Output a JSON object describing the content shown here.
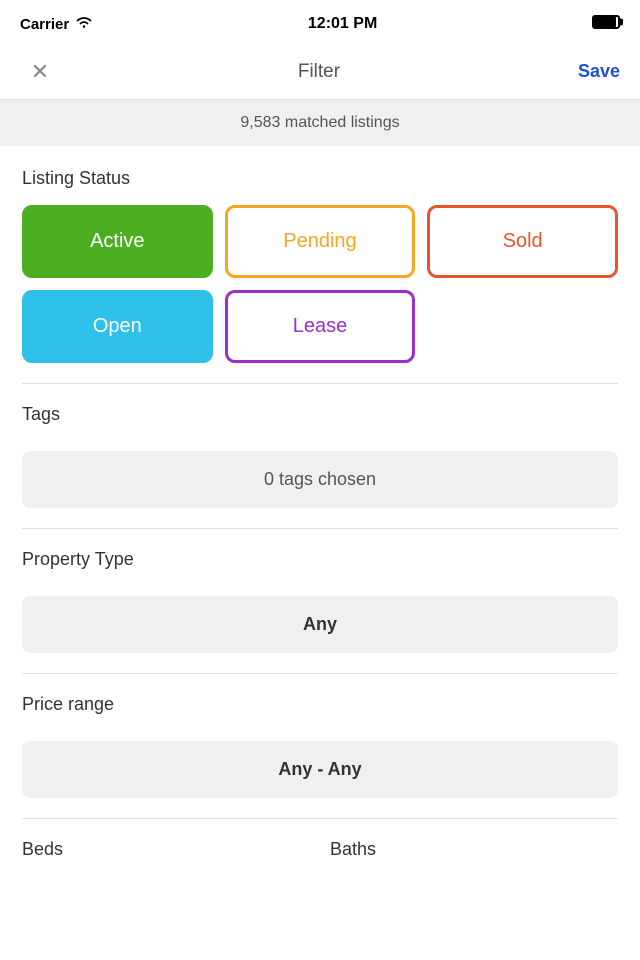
{
  "statusBar": {
    "carrier": "Carrier",
    "time": "12:01 PM"
  },
  "navBar": {
    "closeLabel": "✕",
    "title": "Filter",
    "saveLabel": "Save"
  },
  "matchedBanner": {
    "text": "9,583 matched listings"
  },
  "listingStatus": {
    "sectionTitle": "Listing Status",
    "buttons": [
      {
        "label": "Active",
        "style": "active"
      },
      {
        "label": "Pending",
        "style": "pending"
      },
      {
        "label": "Sold",
        "style": "sold"
      },
      {
        "label": "Open",
        "style": "open"
      },
      {
        "label": "Lease",
        "style": "lease"
      }
    ]
  },
  "tags": {
    "sectionTitle": "Tags",
    "dropdownLabel": "0 tags chosen"
  },
  "propertyType": {
    "sectionTitle": "Property Type",
    "dropdownLabel": "Any"
  },
  "priceRange": {
    "sectionTitle": "Price range",
    "dropdownLabel": "Any - Any"
  },
  "bedsSection": {
    "title": "Beds"
  },
  "bathsSection": {
    "title": "Baths"
  }
}
